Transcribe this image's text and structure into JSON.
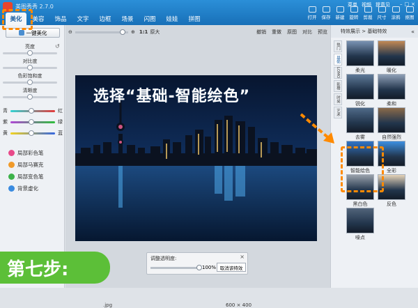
{
  "app": {
    "title": "美图秀秀 2.7.0"
  },
  "tabs": [
    {
      "label": "美化",
      "active": true
    },
    {
      "label": "美容",
      "active": false
    },
    {
      "label": "饰品",
      "active": false
    },
    {
      "label": "文字",
      "active": false
    },
    {
      "label": "边框",
      "active": false
    },
    {
      "label": "场景",
      "active": false
    },
    {
      "label": "闪图",
      "active": false
    },
    {
      "label": "娃娃",
      "active": false
    },
    {
      "label": "拼图",
      "active": false
    }
  ],
  "top_links": [
    "菜单",
    "视频",
    "提意见"
  ],
  "toolbar": [
    {
      "label": "打开"
    },
    {
      "label": "保存"
    },
    {
      "label": "新建"
    },
    {
      "label": "旋转"
    },
    {
      "label": "剪裁"
    },
    {
      "label": "尺寸"
    },
    {
      "label": "涂鸦"
    },
    {
      "label": "抠图"
    }
  ],
  "left": {
    "onekey_label": "一键美化",
    "sliders": [
      {
        "label": "亮度"
      },
      {
        "label": "对比度"
      },
      {
        "label": "色彩饱和度"
      },
      {
        "label": "清晰度"
      }
    ],
    "color_sliders": [
      {
        "left": "青",
        "right": "红",
        "gradient": "linear-gradient(90deg,#31d4d4,#e43a3a)"
      },
      {
        "left": "紫",
        "right": "绿",
        "gradient": "linear-gradient(90deg,#b047d6,#2fbf3c)"
      },
      {
        "left": "黄",
        "right": "蓝",
        "gradient": "linear-gradient(90deg,#f3d320,#3567e0)"
      }
    ],
    "tools": [
      {
        "label": "局部彩色笔",
        "color": "#e84a8a"
      },
      {
        "label": "局部马赛克",
        "color": "#f09a2a"
      },
      {
        "label": "局部变色笔",
        "color": "#3db24a"
      },
      {
        "label": "背景虚化",
        "color": "#3a8be0"
      }
    ]
  },
  "canvas": {
    "zoom_value": "1:1",
    "zoom_label": "原大",
    "actions": [
      "撤销",
      "重做",
      "原图",
      "对比",
      "预览"
    ],
    "file_suffix": ".jpg",
    "dimensions": "600 × 400"
  },
  "opacity_dialog": {
    "title": "调整透明度:",
    "percent": "100%",
    "cancel_label": "取消该特效"
  },
  "right": {
    "breadcrumb": "特效展示 > 基础特效",
    "categories": [
      "热门",
      "基础",
      "LOMO",
      "影楼",
      "时尚",
      "艺术"
    ],
    "effects": [
      {
        "name": "柔光"
      },
      {
        "name": "暖化"
      },
      {
        "name": "锐化"
      },
      {
        "name": "柔和"
      },
      {
        "name": "去雾"
      },
      {
        "name": "自然强烈"
      },
      {
        "name": "智能绘色"
      },
      {
        "name": "全彩"
      },
      {
        "name": "黑白色"
      },
      {
        "name": "反色"
      },
      {
        "name": "噪点"
      }
    ]
  },
  "annotation": {
    "headline": "选择“基础-智能绘色”",
    "step": "第七步:",
    "accent": "#ff8a00",
    "step_color": "#5cbf38"
  }
}
